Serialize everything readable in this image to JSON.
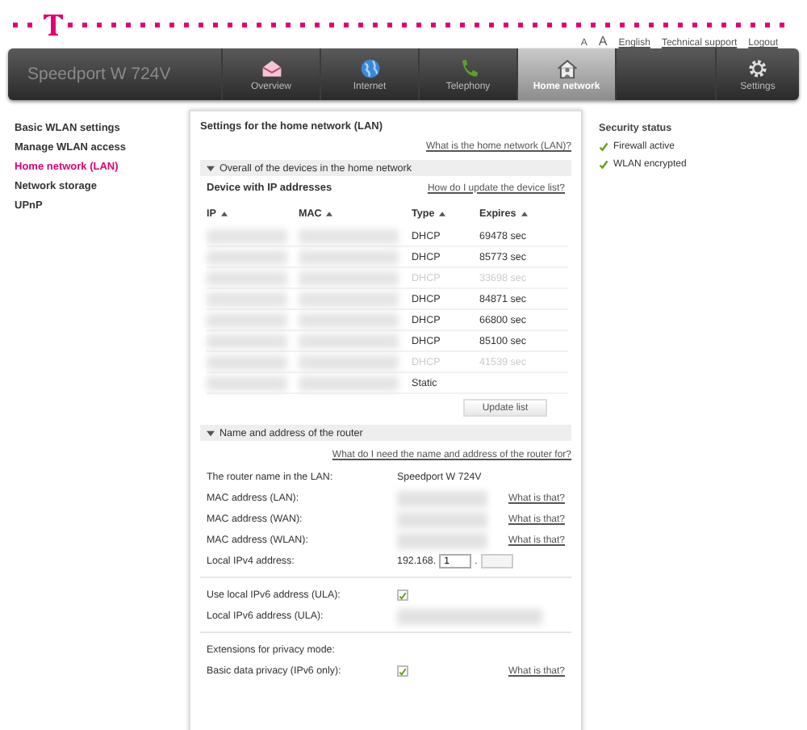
{
  "header": {
    "top_links": [
      {
        "label": "A",
        "kind": "small"
      },
      {
        "label": "A",
        "kind": "large"
      },
      {
        "label": "English",
        "kind": "link"
      },
      {
        "label": "Technical support",
        "kind": "link"
      },
      {
        "label": "Logout",
        "kind": "link"
      }
    ]
  },
  "nav": {
    "product": "Speedport W 724V",
    "tabs": [
      {
        "label": "Overview",
        "kind": "envelope",
        "selected": false
      },
      {
        "label": "Internet",
        "kind": "globe",
        "selected": false
      },
      {
        "label": "Telephony",
        "kind": "phone",
        "selected": false
      },
      {
        "label": "Home network",
        "kind": "house",
        "selected": true
      }
    ],
    "settings": {
      "label": "Settings",
      "kind": "gear",
      "selected": false
    }
  },
  "sidebar": {
    "items": [
      {
        "label": "Basic WLAN settings",
        "selected": false
      },
      {
        "label": "Manage WLAN access",
        "selected": false
      },
      {
        "label": "Home network (LAN)",
        "selected": true
      },
      {
        "label": "Network storage",
        "selected": false
      },
      {
        "label": "UPnP",
        "selected": false
      }
    ]
  },
  "panel": {
    "title": "Settings for the home network (LAN)",
    "help_link": "What is the home network (LAN)?",
    "devices": {
      "title": "Overall of the devices in the home network",
      "expanded": true,
      "subtitle": "Device with IP addresses",
      "help_link": "How do I update the device list?",
      "columns": [
        "IP",
        "MAC",
        "Type",
        "Expires"
      ],
      "rows": [
        {
          "type": "DHCP",
          "expires": "69478 sec",
          "active": true
        },
        {
          "type": "DHCP",
          "expires": "85773 sec",
          "active": true
        },
        {
          "type": "DHCP",
          "expires": "33698 sec",
          "active": false
        },
        {
          "type": "DHCP",
          "expires": "84871 sec",
          "active": true
        },
        {
          "type": "DHCP",
          "expires": "66800 sec",
          "active": true
        },
        {
          "type": "DHCP",
          "expires": "85100 sec",
          "active": true
        },
        {
          "type": "DHCP",
          "expires": "41539 sec",
          "active": false
        },
        {
          "type": "Static",
          "active": true
        }
      ],
      "button": "Update list"
    },
    "router": {
      "title": "Name and address of the router",
      "expanded": true,
      "help_link": "What do I need the name and address of the router for?",
      "groups": [
        [
          {
            "kind": "text",
            "label": "The router name in the LAN:",
            "value": "Speedport W 724V"
          },
          {
            "kind": "hidden",
            "label": "MAC address (LAN):",
            "help": "What is that?"
          },
          {
            "kind": "hidden",
            "label": "MAC address (WAN):",
            "help": "What is that?"
          },
          {
            "kind": "hidden",
            "label": "MAC address (WLAN):",
            "help": "What is that?"
          },
          {
            "kind": "ipv4",
            "label": "Local IPv4 address:",
            "prefix": "192.168.",
            "value": "1",
            "separator": "."
          }
        ],
        [
          {
            "kind": "checkbox",
            "label": "Use local IPv6 address (ULA):",
            "checked": true
          },
          {
            "kind": "hidden",
            "label": "Local IPv6 address (ULA):"
          }
        ],
        [
          {
            "kind": "label",
            "label": "Extensions for privacy mode:"
          },
          {
            "kind": "checkbox",
            "label": "Basic data privacy (IPv6 only):",
            "checked": true,
            "help": "What is that?"
          }
        ]
      ]
    }
  },
  "security_status": {
    "title": "Security status",
    "items": [
      {
        "label": "Firewall active"
      },
      {
        "label": "WLAN encrypted"
      }
    ]
  }
}
